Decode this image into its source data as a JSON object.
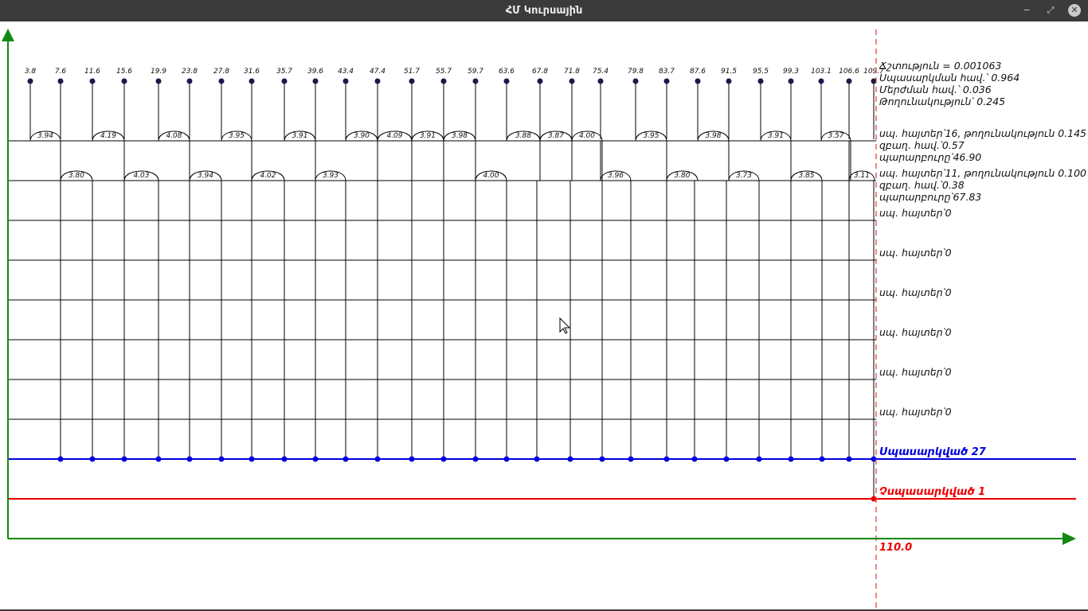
{
  "window": {
    "title": "ՀՄ Կուրսային",
    "minimize_icon": "−",
    "maximize_icon": "⤢",
    "close_icon": "✕"
  },
  "colors": {
    "axis": "#118811",
    "served": "#0000dd",
    "refused": "#ee0000",
    "grid": "#000000",
    "dot": "#1a1a4a",
    "dashed": "#ee3333"
  },
  "arrivals": [
    3.8,
    7.6,
    11.6,
    15.6,
    19.9,
    23.8,
    27.8,
    31.6,
    35.7,
    39.6,
    43.4,
    47.4,
    51.7,
    55.7,
    59.7,
    63.6,
    67.8,
    71.8,
    75.4,
    79.8,
    83.7,
    87.6,
    91.5,
    95.5,
    99.3,
    103.1,
    106.6,
    109.7
  ],
  "arrival_labels": [
    "3.8",
    "7.6",
    "11.6",
    "15.6",
    "19.9",
    "23.8",
    "27.8",
    "31.6",
    "35.7",
    "39.6",
    "43.4",
    "47.4",
    "51.7",
    "55.7",
    "59.7",
    "63.6",
    "67.8",
    "71.8",
    "75.4",
    "79.8",
    "83.7",
    "87.6",
    "91.5",
    "95.5",
    "99.3",
    "103.1",
    "106.6",
    "109.7"
  ],
  "channels": [
    {
      "services": [
        {
          "start": 3.8,
          "end": 7.6,
          "label": "3.94"
        },
        {
          "start": 11.6,
          "end": 15.6,
          "label": "4.19"
        },
        {
          "start": 19.9,
          "end": 23.8,
          "label": "4.08"
        },
        {
          "start": 27.8,
          "end": 31.6,
          "label": "3.95"
        },
        {
          "start": 35.7,
          "end": 39.6,
          "label": "3.91"
        },
        {
          "start": 43.4,
          "end": 47.4,
          "label": "3.90"
        },
        {
          "start": 47.4,
          "end": 51.7,
          "label": "4.09"
        },
        {
          "start": 51.7,
          "end": 55.7,
          "label": "3.91"
        },
        {
          "start": 55.7,
          "end": 59.7,
          "label": "3.98"
        },
        {
          "start": 63.6,
          "end": 67.8,
          "label": "3.88"
        },
        {
          "start": 67.8,
          "end": 71.8,
          "label": "3.87"
        },
        {
          "start": 71.8,
          "end": 75.6,
          "label": "4.00"
        },
        {
          "start": 79.8,
          "end": 83.7,
          "label": "3.95"
        },
        {
          "start": 87.6,
          "end": 91.5,
          "label": "3.98"
        },
        {
          "start": 95.5,
          "end": 99.3,
          "label": "3.91"
        },
        {
          "start": 103.1,
          "end": 106.8,
          "label": "3.57"
        }
      ]
    },
    {
      "services": [
        {
          "start": 7.6,
          "end": 11.6,
          "label": "3.80"
        },
        {
          "start": 15.6,
          "end": 19.9,
          "label": "4.03"
        },
        {
          "start": 23.8,
          "end": 27.8,
          "label": "3.94"
        },
        {
          "start": 31.6,
          "end": 35.7,
          "label": "4.02"
        },
        {
          "start": 39.6,
          "end": 43.4,
          "label": "3.93"
        },
        {
          "start": 59.7,
          "end": 63.6,
          "label": "4.00"
        },
        {
          "start": 75.4,
          "end": 79.2,
          "label": "3.96"
        },
        {
          "start": 83.7,
          "end": 87.6,
          "label": "3.80"
        },
        {
          "start": 91.5,
          "end": 95.3,
          "label": "3.73"
        },
        {
          "start": 99.3,
          "end": 103.2,
          "label": "3.85"
        },
        {
          "start": 106.6,
          "end": 109.8,
          "label": "3.11"
        }
      ]
    },
    {
      "services": []
    },
    {
      "services": []
    },
    {
      "services": []
    },
    {
      "services": []
    },
    {
      "services": []
    },
    {
      "services": []
    }
  ],
  "served_points": [
    7.6,
    11.6,
    15.6,
    19.9,
    23.8,
    27.8,
    31.6,
    35.7,
    39.6,
    43.4,
    47.4,
    51.7,
    55.7,
    59.7,
    63.6,
    67.4,
    71.6,
    75.6,
    79.2,
    83.7,
    87.2,
    91.2,
    95.3,
    99.3,
    103.2,
    106.6,
    109.7
  ],
  "refused_points": [
    109.7
  ],
  "stats": {
    "line1": "Ճշտություն = 0.001063",
    "line2": "Սպասարկման հավ.՝ 0.964",
    "line3": "Մերժման հավ.՝ 0.036",
    "line4": "Թողունակություն՝ 0.245"
  },
  "channel_info": [
    [
      "սպ. հայտեր՝16, թողունակություն 0.145",
      "զբաղ. հավ.՝0.57",
      "պարարբուրը՝46.90"
    ],
    [
      "սպ. հայտեր՝11, թողունակություն 0.100",
      "զբաղ. հավ.՝0.38",
      "պարարբուրը՝67.83"
    ],
    [
      "սպ. հայտեր՝0"
    ],
    [
      "սպ. հայտեր՝0"
    ],
    [
      "սպ. հայտեր՝0"
    ],
    [
      "սպ. հայտեր՝0"
    ],
    [
      "սպ. հայտեր՝0"
    ],
    [
      "սպ. հայտեր՝0"
    ]
  ],
  "served_label": "Սպասարկված  27",
  "refused_label": "Չսպասարկված  1",
  "time_end_label": "110.0",
  "time_end": 110.0
}
